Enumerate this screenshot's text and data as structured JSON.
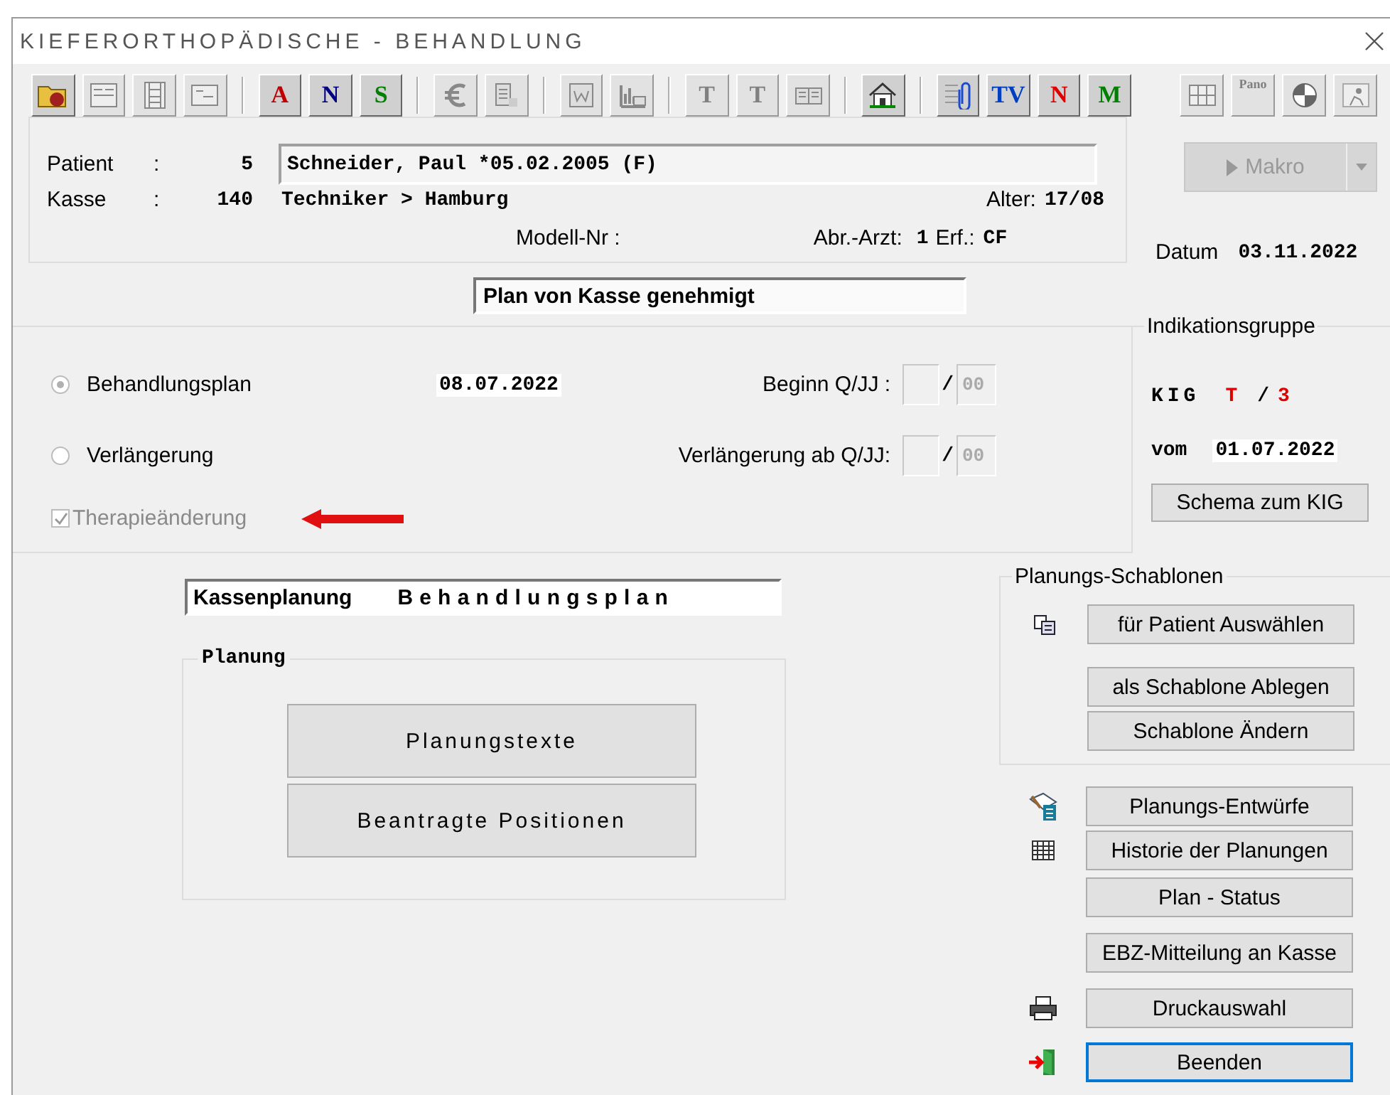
{
  "window": {
    "title": "KIEFERORTHOPÄDISCHE - BEHANDLUNG"
  },
  "toolbar": {
    "groups": [
      [
        {
          "kind": "icon",
          "disabled": false
        },
        {
          "kind": "icon",
          "disabled": true
        },
        {
          "kind": "icon",
          "disabled": true
        },
        {
          "kind": "icon",
          "disabled": true
        }
      ],
      [
        {
          "kind": "letter",
          "label": "A",
          "color": "#c00000",
          "disabled": false
        },
        {
          "kind": "letter",
          "label": "N",
          "color": "#000080",
          "disabled": false
        },
        {
          "kind": "letter",
          "label": "S",
          "color": "#008000",
          "disabled": false
        }
      ],
      [
        {
          "kind": "icon",
          "disabled": true
        },
        {
          "kind": "icon",
          "disabled": true
        }
      ],
      [
        {
          "kind": "icon",
          "disabled": true
        },
        {
          "kind": "icon",
          "disabled": true
        }
      ],
      [
        {
          "kind": "letter",
          "label": "T",
          "color": "#808080",
          "disabled": true
        },
        {
          "kind": "letter",
          "label": "T",
          "color": "#808080",
          "disabled": true
        },
        {
          "kind": "icon",
          "disabled": true
        }
      ],
      [
        {
          "kind": "icon",
          "disabled": false
        }
      ],
      [
        {
          "kind": "icon",
          "disabled": false
        },
        {
          "kind": "letter",
          "label": "TV",
          "color": "#0040c0",
          "disabled": false
        },
        {
          "kind": "letter",
          "label": "N",
          "color": "#e00000",
          "disabled": false
        },
        {
          "kind": "letter",
          "label": "M",
          "color": "#008000",
          "disabled": false
        }
      ]
    ]
  },
  "side_toolbar": [
    {
      "kind": "icon",
      "disabled": true
    },
    {
      "kind": "letter",
      "label": "Pano",
      "color": "#808080",
      "disabled": true
    },
    {
      "kind": "icon",
      "disabled": true
    },
    {
      "kind": "icon",
      "disabled": true
    }
  ],
  "patient": {
    "label": "Patient",
    "colon": ":",
    "number": "5",
    "name": "Schneider, Paul *05.02.2005 (F)"
  },
  "kasse": {
    "label": "Kasse",
    "colon": ":",
    "number": "140",
    "name": "Techniker > Hamburg",
    "age_label": "Alter:",
    "age": "17/08"
  },
  "details": {
    "model_label": "Modell-Nr :",
    "abr_label": "Abr.-Arzt:",
    "abr_value": "1",
    "erf_label": "Erf.:",
    "erf_value": "CF"
  },
  "makro": {
    "label": "Makro",
    "disabled": true
  },
  "datum": {
    "label": "Datum",
    "value": "03.11.2022"
  },
  "plan_status": "Plan von Kasse genehmigt",
  "options": [
    {
      "kind": "radio",
      "label": "Behandlungsplan",
      "selected": true,
      "date": "08.07.2022",
      "q_label": "Beginn Q/JJ :",
      "separator": "/",
      "year": "00"
    },
    {
      "kind": "radio",
      "label": "Verlängerung",
      "selected": false,
      "q_label": "Verlängerung ab Q/JJ:",
      "separator": "/",
      "year": "00"
    },
    {
      "kind": "checkbox",
      "label": "Therapieänderung",
      "checked": true,
      "disabled": true
    }
  ],
  "indikation": {
    "title": "Indikationsgruppe",
    "kig_label": "KIG",
    "kig_group": "T",
    "kig_sep": "/",
    "kig_level": "3",
    "vom_label": "vom",
    "vom_value": "01.07.2022",
    "schema_button": "Schema zum KIG"
  },
  "planning_field": {
    "label": "Kassenplanung",
    "value": "Behandlungsplan"
  },
  "planung": {
    "title": "Planung",
    "buttons": [
      "Planungstexte",
      "Beantragte Positionen"
    ]
  },
  "templates": {
    "title": "Planungs-Schablonen",
    "buttons": [
      {
        "kind": "icon",
        "label": "für Patient Auswählen"
      },
      {
        "kind": "plain",
        "label": "als Schablone Ablegen"
      },
      {
        "kind": "plain",
        "label": "Schablone Ändern"
      }
    ]
  },
  "actions": [
    {
      "kind": "icon",
      "label": "Planungs-Entwürfe",
      "focused": false
    },
    {
      "kind": "icon",
      "label": "Historie der Planungen",
      "focused": false
    },
    {
      "kind": "plain",
      "label": "Plan - Status",
      "focused": false
    },
    {
      "kind": "plain",
      "label": "EBZ-Mitteilung an Kasse",
      "focused": false
    },
    {
      "kind": "icon",
      "label": "Druckauswahl",
      "focused": false
    },
    {
      "kind": "icon",
      "label": "Beenden",
      "focused": true
    }
  ]
}
